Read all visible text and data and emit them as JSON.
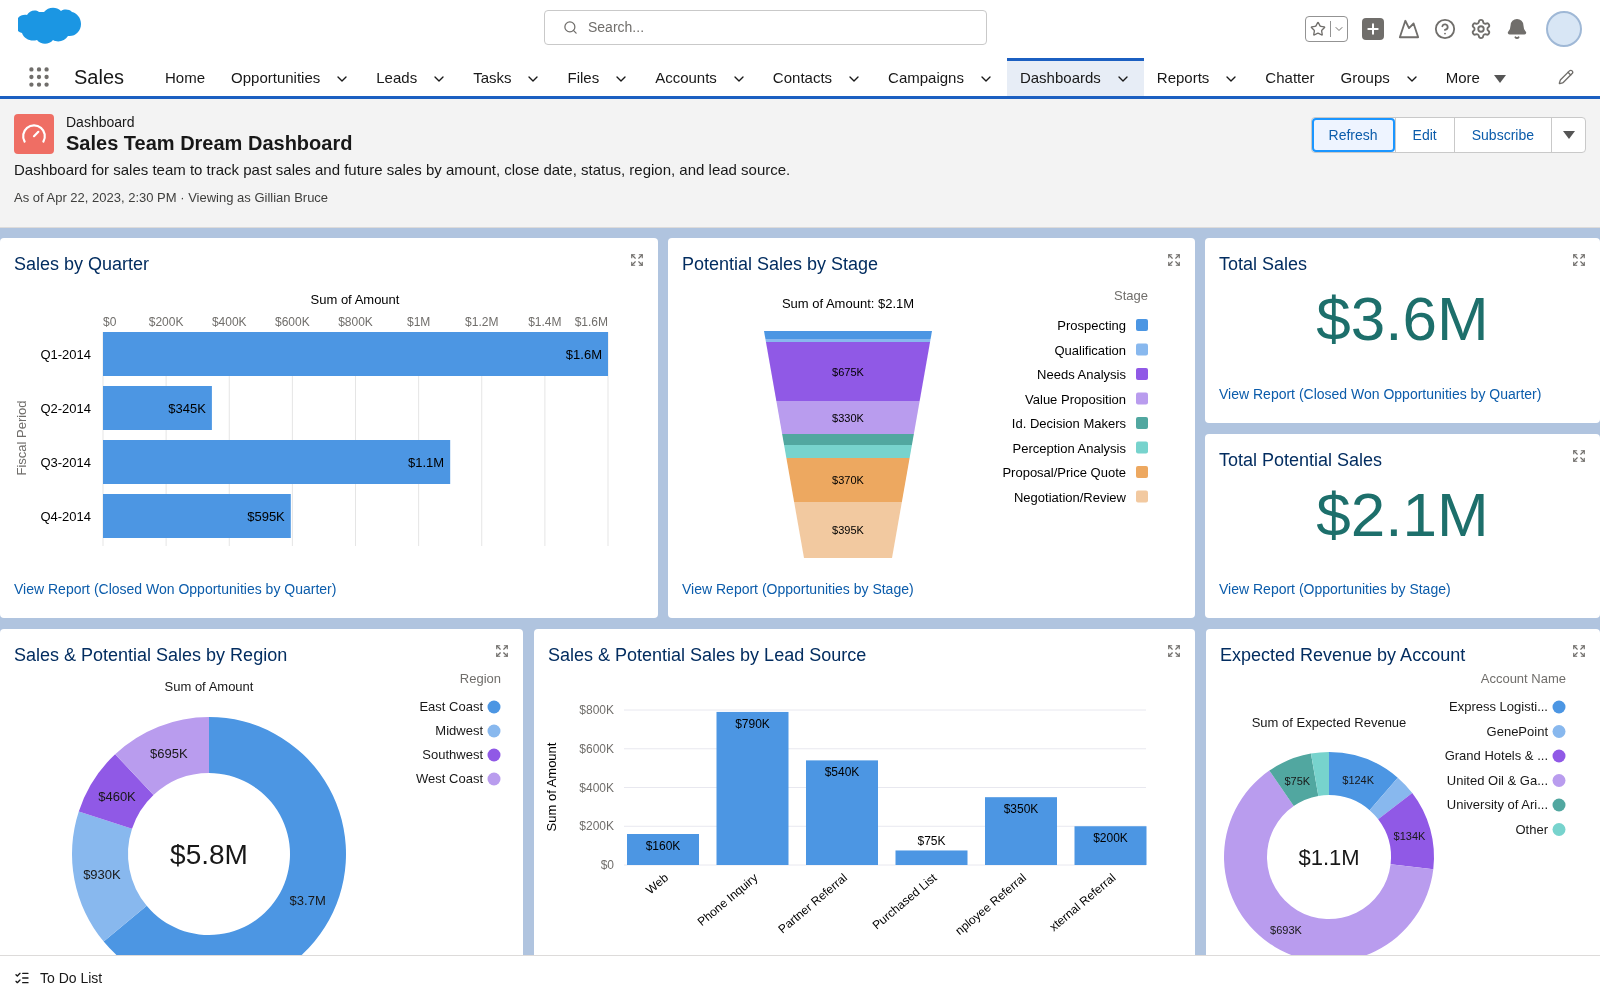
{
  "top_bar": {
    "search": {
      "placeholder": "Search..."
    }
  },
  "nav": {
    "app_name": "Sales",
    "items": [
      {
        "kind": "link",
        "label": "Home",
        "selected": false
      },
      {
        "kind": "dropdown",
        "label": "Opportunities",
        "selected": false
      },
      {
        "kind": "dropdown",
        "label": "Leads",
        "selected": false
      },
      {
        "kind": "dropdown",
        "label": "Tasks",
        "selected": false
      },
      {
        "kind": "dropdown",
        "label": "Files",
        "selected": false
      },
      {
        "kind": "dropdown",
        "label": "Accounts",
        "selected": false
      },
      {
        "kind": "dropdown",
        "label": "Contacts",
        "selected": false
      },
      {
        "kind": "dropdown",
        "label": "Campaigns",
        "selected": false
      },
      {
        "kind": "dropdown",
        "label": "Dashboards",
        "selected": true
      },
      {
        "kind": "dropdown",
        "label": "Reports",
        "selected": false
      },
      {
        "kind": "link",
        "label": "Chatter",
        "selected": false
      },
      {
        "kind": "dropdown",
        "label": "Groups",
        "selected": false
      },
      {
        "kind": "overflow",
        "label": "More",
        "selected": false
      }
    ]
  },
  "page_header": {
    "object_type": "Dashboard",
    "title": "Sales Team Dream Dashboard",
    "description": "Dashboard for sales team to track past sales and future sales by amount, close date, status, region, and lead source.",
    "as_of": "As of Apr 22, 2023, 2:30 PM · Viewing as Gillian Bruce",
    "buttons": [
      {
        "kind": "text",
        "label": "Refresh",
        "selected": true
      },
      {
        "kind": "text",
        "label": "Edit",
        "selected": false
      },
      {
        "kind": "text",
        "label": "Subscribe",
        "selected": false
      },
      {
        "kind": "menu",
        "selected": false
      }
    ]
  },
  "sales_by_quarter": {
    "title": "Sales by Quarter",
    "link": "View Report (Closed Won Opportunities by Quarter)",
    "chart_data": {
      "type": "bar",
      "orientation": "horizontal",
      "grid": true,
      "xlabel": "Sum of Amount",
      "ylabel": "Fiscal Period",
      "categories": [
        "Q1-2014",
        "Q2-2014",
        "Q3-2014",
        "Q4-2014"
      ],
      "values": [
        1600000,
        345000,
        1100000,
        595000
      ],
      "value_labels": [
        "$1.6M",
        "$345K",
        "$1.1M",
        "$595K"
      ],
      "xlim": [
        0,
        1600000
      ],
      "xticks": [
        {
          "value": 0,
          "label": "$0"
        },
        {
          "value": 200000,
          "label": "$200K"
        },
        {
          "value": 400000,
          "label": "$400K"
        },
        {
          "value": 600000,
          "label": "$600K"
        },
        {
          "value": 800000,
          "label": "$800K"
        },
        {
          "value": 1000000,
          "label": "$1M"
        },
        {
          "value": 1200000,
          "label": "$1.2M"
        },
        {
          "value": 1400000,
          "label": "$1.4M"
        },
        {
          "value": 1600000,
          "label": "$1.6M"
        }
      ]
    }
  },
  "potential_by_stage": {
    "title": "Potential Sales by Stage",
    "funnel_label": "Sum of Amount: $2.1M",
    "legend_title": "Stage",
    "link": "View Report (Opportunities by Stage)",
    "segments": [
      {
        "name": "Prospecting",
        "color": "#4c96e3"
      },
      {
        "name": "Qualification",
        "color": "#88b8ee"
      },
      {
        "name": "Needs Analysis",
        "color": "#9059e6",
        "value_label": "$675K"
      },
      {
        "name": "Value Proposition",
        "color": "#b99cee",
        "value_label": "$330K"
      },
      {
        "name": "Id. Decision Makers",
        "color": "#51a7a0"
      },
      {
        "name": "Perception Analysis",
        "color": "#77d3cd"
      },
      {
        "name": "Proposal/Price Quote",
        "color": "#eda860",
        "value_label": "$370K"
      },
      {
        "name": "Negotiation/Review",
        "color": "#f2c9a0",
        "value_label": "$395K"
      }
    ]
  },
  "total_sales": {
    "title": "Total Sales",
    "value": "$3.6M",
    "link": "View Report (Closed Won Opportunities by Quarter)"
  },
  "total_potential_sales": {
    "title": "Total Potential Sales",
    "value": "$2.1M",
    "link": "View Report (Opportunities by Stage)"
  },
  "by_region": {
    "title": "Sales & Potential Sales by Region",
    "center_value": "$5.8M",
    "legend": {
      "title": "Region",
      "items": [
        {
          "color": "#4c96e3"
        },
        {
          "color": "#88b8ee"
        },
        {
          "color": "#9059e6"
        },
        {
          "color": "#b99cee"
        }
      ]
    },
    "chart_data": {
      "type": "donut",
      "legend": "right",
      "title": "Sum of Amount",
      "categories": [
        "East Coast",
        "Midwest",
        "Southwest",
        "West Coast"
      ],
      "values": [
        3700000,
        930000,
        460000,
        695000
      ],
      "value_labels": [
        "$3.7M",
        "$930K",
        "$460K",
        "$695K"
      ]
    }
  },
  "by_lead_source": {
    "title": "Sales & Potential Sales by Lead Source",
    "chart_data": {
      "type": "bar",
      "orientation": "vertical",
      "grid": true,
      "ylabel": "Sum of Amount",
      "categories": [
        "Web",
        "Phone Inquiry",
        "Partner Referral",
        "Purchased List",
        "nployee Referral",
        "xternal Referral"
      ],
      "values": [
        160000,
        790000,
        540000,
        75000,
        350000,
        200000
      ],
      "value_labels": [
        "$160K",
        "$790K",
        "$540K",
        "$75K",
        "$350K",
        "$200K"
      ],
      "ylim": [
        0,
        800000
      ],
      "yticks": [
        {
          "value": 0,
          "label": "$0"
        },
        {
          "value": 200000,
          "label": "$200K"
        },
        {
          "value": 400000,
          "label": "$400K"
        },
        {
          "value": 600000,
          "label": "$600K"
        },
        {
          "value": 800000,
          "label": "$800K"
        }
      ]
    }
  },
  "expected_revenue": {
    "title": "Expected Revenue by Account",
    "center_value": "$1.1M",
    "legend": {
      "title": "Account Name",
      "items": [
        {
          "color": "#4c96e3"
        },
        {
          "color": "#88b8ee"
        },
        {
          "color": "#9059e6"
        },
        {
          "color": "#b99cee"
        },
        {
          "color": "#51a7a0"
        },
        {
          "color": "#77d3cd"
        }
      ]
    },
    "chart_data": {
      "type": "donut",
      "legend": "right",
      "title": "Sum of Expected Revenue",
      "categories": [
        "Express Logisti...",
        "GenePoint",
        "Grand Hotels & ...",
        "United Oil & Ga...",
        "University of Ari...",
        "Other"
      ],
      "values": [
        124000,
        35000,
        134000,
        693000,
        75000,
        30000
      ],
      "value_labels": [
        "$124K",
        null,
        "$134K",
        "$693K",
        "$75K",
        null
      ]
    }
  },
  "footer": {
    "label": "To Do List"
  }
}
